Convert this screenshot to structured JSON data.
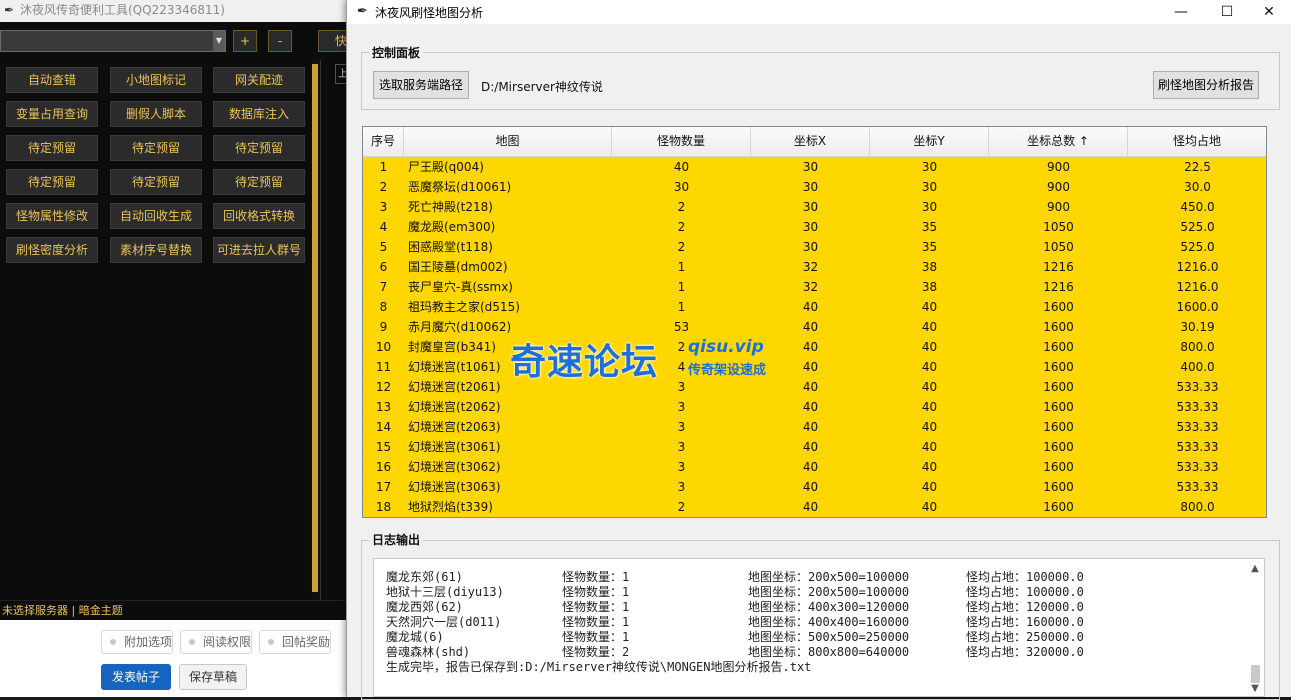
{
  "bg_window": {
    "title": "沐夜风传奇便利工具(QQ223346811)",
    "plus_label": "+",
    "minus_label": "-",
    "quick_label": "快",
    "tools": [
      [
        "自动查错",
        "小地图标记",
        "网关配迹"
      ],
      [
        "变量占用查询",
        "删假人脚本",
        "数据库注入"
      ],
      [
        "待定预留",
        "待定预留",
        "待定预留"
      ],
      [
        "待定预留",
        "待定预留",
        "待定预留"
      ],
      [
        "怪物属性修改",
        "自动回收生成",
        "回收格式转换"
      ],
      [
        "刷怪密度分析",
        "素材序号替换",
        "可进去拉人群号"
      ]
    ],
    "right_box_label": "上",
    "status": "未选择服务器 | 暗金主题",
    "forum_options": [
      "附加选项",
      "阅读权限",
      "回帖奖励"
    ],
    "publish_label": "发表帖子",
    "draft_label": "保存草稿"
  },
  "fg_window": {
    "title": "沐夜风刷怪地图分析",
    "controls": {
      "minimize": "—",
      "maximize": "☐",
      "close": "✕"
    },
    "control_panel": {
      "label": "控制面板",
      "select_path_button": "选取服务端路径",
      "path": "D:/Mirserver神纹传说",
      "report_button": "刷怪地图分析报告"
    },
    "table": {
      "columns": [
        "序号",
        "地图",
        "怪物数量",
        "坐标X",
        "坐标Y",
        "坐标总数 ↑",
        "怪均占地"
      ],
      "rows": [
        [
          "1",
          "尸王殿(q004)",
          "40",
          "30",
          "30",
          "900",
          "22.5"
        ],
        [
          "2",
          "恶魔祭坛(d10061)",
          "30",
          "30",
          "30",
          "900",
          "30.0"
        ],
        [
          "3",
          "死亡神殿(t218)",
          "2",
          "30",
          "30",
          "900",
          "450.0"
        ],
        [
          "4",
          "魔龙殿(em300)",
          "2",
          "30",
          "35",
          "1050",
          "525.0"
        ],
        [
          "5",
          "困惑殿堂(t118)",
          "2",
          "30",
          "35",
          "1050",
          "525.0"
        ],
        [
          "6",
          "国王陵墓(dm002)",
          "1",
          "32",
          "38",
          "1216",
          "1216.0"
        ],
        [
          "7",
          "丧尸皇穴-真(ssmx)",
          "1",
          "32",
          "38",
          "1216",
          "1216.0"
        ],
        [
          "8",
          "祖玛教主之家(d515)",
          "1",
          "40",
          "40",
          "1600",
          "1600.0"
        ],
        [
          "9",
          "赤月魔穴(d10062)",
          "53",
          "40",
          "40",
          "1600",
          "30.19"
        ],
        [
          "10",
          "封魔皇宫(b341)",
          "2",
          "40",
          "40",
          "1600",
          "800.0"
        ],
        [
          "11",
          "幻境迷宫(t1061)",
          "4",
          "40",
          "40",
          "1600",
          "400.0"
        ],
        [
          "12",
          "幻境迷宫(t2061)",
          "3",
          "40",
          "40",
          "1600",
          "533.33"
        ],
        [
          "13",
          "幻境迷宫(t2062)",
          "3",
          "40",
          "40",
          "1600",
          "533.33"
        ],
        [
          "14",
          "幻境迷宫(t2063)",
          "3",
          "40",
          "40",
          "1600",
          "533.33"
        ],
        [
          "15",
          "幻境迷宫(t3061)",
          "3",
          "40",
          "40",
          "1600",
          "533.33"
        ],
        [
          "16",
          "幻境迷宫(t3062)",
          "3",
          "40",
          "40",
          "1600",
          "533.33"
        ],
        [
          "17",
          "幻境迷宫(t3063)",
          "3",
          "40",
          "40",
          "1600",
          "533.33"
        ],
        [
          "18",
          "地狱烈焰(t339)",
          "2",
          "40",
          "40",
          "1600",
          "800.0"
        ]
      ]
    },
    "watermark": {
      "main": "奇速论坛",
      "domain": "qisu.vip",
      "sub": "传奇架设速成"
    },
    "log": {
      "label": "日志输出",
      "lines": [
        [
          "魔龙东郊(61)",
          "怪物数量：1",
          "地图坐标：200x500=100000",
          "怪均占地：100000.0"
        ],
        [
          "地狱十三层(diyu13)",
          "怪物数量：1",
          "地图坐标：200x500=100000",
          "怪均占地：100000.0"
        ],
        [
          "魔龙西郊(62)",
          "怪物数量：1",
          "地图坐标：400x300=120000",
          "怪均占地：120000.0"
        ],
        [
          "天然洞穴一层(d011)",
          "怪物数量：1",
          "地图坐标：400x400=160000",
          "怪均占地：160000.0"
        ],
        [
          "魔龙城(6)",
          "怪物数量：1",
          "地图坐标：500x500=250000",
          "怪均占地：250000.0"
        ],
        [
          "兽魂森林(shd)",
          "怪物数量：2",
          "地图坐标：800x800=640000",
          "怪均占地：320000.0"
        ]
      ],
      "final": "生成完毕，报告已保存到:D:/Mirserver神纹传说\\MONGEN地图分析报告.txt"
    }
  }
}
